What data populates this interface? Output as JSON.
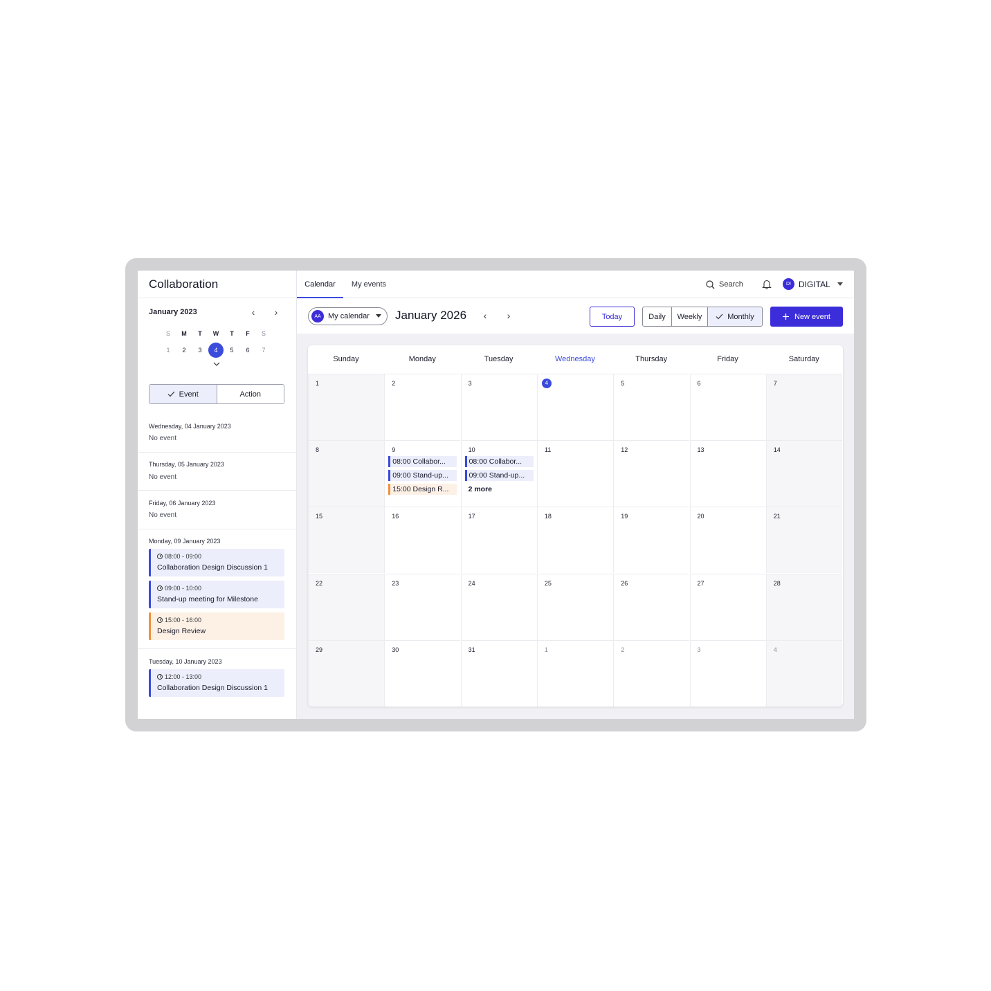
{
  "app": {
    "title": "Collaboration"
  },
  "nav": {
    "tabs": [
      {
        "label": "Calendar"
      },
      {
        "label": "My events"
      }
    ],
    "search_label": "Search",
    "user": {
      "initials": "DI",
      "name": "DIGITAL"
    }
  },
  "mini_calendar": {
    "title": "January 2023",
    "weekdays": [
      "S",
      "M",
      "T",
      "W",
      "T",
      "F",
      "S"
    ],
    "days": [
      "1",
      "2",
      "3",
      "4",
      "5",
      "6",
      "7"
    ],
    "selected": "4"
  },
  "filter": {
    "event_label": "Event",
    "action_label": "Action"
  },
  "agenda": [
    {
      "date": "Wednesday, 04 January 2023",
      "empty": "No event"
    },
    {
      "date": "Thursday, 05 January 2023",
      "empty": "No event"
    },
    {
      "date": "Friday, 06 January 2023",
      "empty": "No event"
    },
    {
      "date": "Monday, 09 January 2023",
      "events": [
        {
          "time": "08:00 - 09:00",
          "name": "Collaboration Design Discussion 1"
        },
        {
          "time": "09:00 - 10:00",
          "name": "Stand-up meeting for Milestone"
        },
        {
          "time": "15:00 - 16:00",
          "name": "Design Review"
        }
      ]
    },
    {
      "date": "Tuesday, 10 January 2023",
      "events": [
        {
          "time": "12:00 - 13:00",
          "name": "Collaboration Design Discussion 1"
        }
      ]
    }
  ],
  "toolbar": {
    "calendar_select": {
      "initials": "AA",
      "label": "My calendar"
    },
    "month_title": "January 2026",
    "today_label": "Today",
    "views": [
      "Daily",
      "Weekly",
      "Monthly"
    ],
    "active_view": "Monthly",
    "new_event_label": "New event"
  },
  "month": {
    "weekdays": [
      "Sunday",
      "Monday",
      "Tuesday",
      "Wednesday",
      "Thursday",
      "Friday",
      "Saturday"
    ],
    "weeks": [
      [
        "1",
        "2",
        "3",
        "4",
        "5",
        "6",
        "7"
      ],
      [
        "8",
        "9",
        "10",
        "11",
        "12",
        "13",
        "14"
      ],
      [
        "15",
        "16",
        "17",
        "18",
        "19",
        "20",
        "21"
      ],
      [
        "22",
        "23",
        "24",
        "25",
        "26",
        "27",
        "28"
      ],
      [
        "29",
        "30",
        "31",
        "1",
        "2",
        "3",
        "4"
      ]
    ],
    "today": "4",
    "chips": {
      "mon9": [
        "08:00 Collabor...",
        "09:00 Stand-up...",
        "15:00 Design R..."
      ],
      "tue10": [
        "08:00 Collabor...",
        "09:00 Stand-up..."
      ],
      "tue10_more": "2 more"
    }
  },
  "colors": {
    "accent": "#3b2dd9",
    "event_blue": "#3b4bdb",
    "event_orange": "#f0913a"
  }
}
